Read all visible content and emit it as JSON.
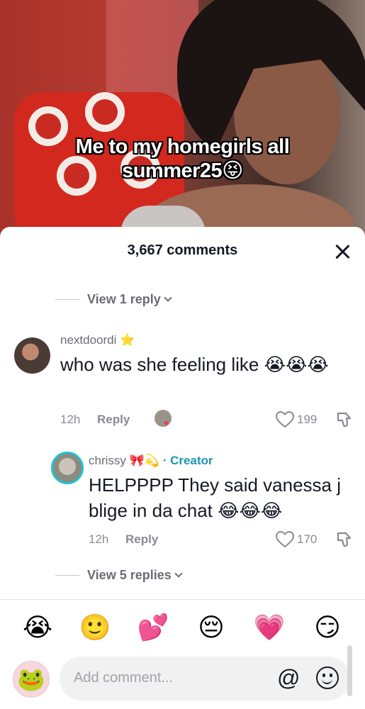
{
  "video": {
    "caption": "Me to my homegirls all summer25😝"
  },
  "sheet": {
    "title": "3,667 comments"
  },
  "top_replies": {
    "label": "View 1 reply"
  },
  "comments": [
    {
      "username": "nextdoordi ⭐",
      "text": "who was she feeling like 😭😭😭",
      "time": "12h",
      "reply_label": "Reply",
      "likes": "199"
    },
    {
      "username": "chrissy 🎀💫",
      "badge": "· Creator",
      "text": "HELPPPP They said vanessa j blige in da chat 😂😂😂",
      "time": "12h",
      "reply_label": "Reply",
      "likes": "170"
    }
  ],
  "bottom_replies": {
    "label": "View 5 replies"
  },
  "quick_emojis": [
    "😭",
    "🙂",
    "💕",
    "😔",
    "💗",
    "😏"
  ],
  "composer": {
    "placeholder": "Add comment...",
    "mention_symbol": "@"
  }
}
